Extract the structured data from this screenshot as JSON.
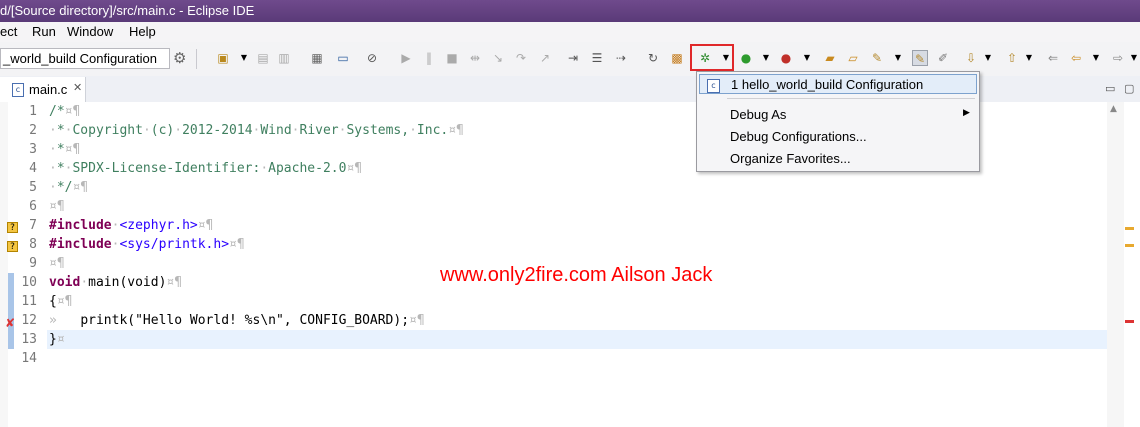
{
  "window": {
    "title": "d/[Source directory]/src/main.c - Eclipse IDE"
  },
  "menu": [
    "ect",
    "Run",
    "Window",
    "Help"
  ],
  "toolbar": {
    "launch_config": "_world_build Configuration"
  },
  "tab": {
    "label": "main.c"
  },
  "editor": {
    "line_numbers": [
      "1",
      "2",
      "3",
      "4",
      "5",
      "6",
      "7",
      "8",
      "9",
      "10",
      "11",
      "12",
      "13",
      "14"
    ],
    "lines": [
      {
        "parts": [
          {
            "c": "cm",
            "t": "/*"
          },
          {
            "c": "ws",
            "t": "¤¶"
          }
        ]
      },
      {
        "parts": [
          {
            "c": "ws",
            "t": "·"
          },
          {
            "c": "cm",
            "t": "*"
          },
          {
            "c": "ws",
            "t": "·"
          },
          {
            "c": "cm",
            "t": "Copyright"
          },
          {
            "c": "ws",
            "t": "·"
          },
          {
            "c": "cm",
            "t": "(c)"
          },
          {
            "c": "ws",
            "t": "·"
          },
          {
            "c": "cm",
            "t": "2012-2014"
          },
          {
            "c": "ws",
            "t": "·"
          },
          {
            "c": "cm",
            "t": "Wind"
          },
          {
            "c": "ws",
            "t": "·"
          },
          {
            "c": "cm",
            "t": "River"
          },
          {
            "c": "ws",
            "t": "·"
          },
          {
            "c": "cm",
            "t": "Systems,"
          },
          {
            "c": "ws",
            "t": "·"
          },
          {
            "c": "cm",
            "t": "Inc."
          },
          {
            "c": "ws",
            "t": "¤¶"
          }
        ]
      },
      {
        "parts": [
          {
            "c": "ws",
            "t": "·"
          },
          {
            "c": "cm",
            "t": "*"
          },
          {
            "c": "ws",
            "t": "¤¶"
          }
        ]
      },
      {
        "parts": [
          {
            "c": "ws",
            "t": "·"
          },
          {
            "c": "cm",
            "t": "*"
          },
          {
            "c": "ws",
            "t": "·"
          },
          {
            "c": "cm",
            "t": "SPDX-License-Identifier:"
          },
          {
            "c": "ws",
            "t": "·"
          },
          {
            "c": "cm",
            "t": "Apache-2.0"
          },
          {
            "c": "ws",
            "t": "¤¶"
          }
        ]
      },
      {
        "parts": [
          {
            "c": "ws",
            "t": "·"
          },
          {
            "c": "cm",
            "t": "*/"
          },
          {
            "c": "ws",
            "t": "¤¶"
          }
        ]
      },
      {
        "parts": [
          {
            "c": "ws",
            "t": "¤¶"
          }
        ]
      },
      {
        "parts": [
          {
            "c": "kw",
            "t": "#include"
          },
          {
            "c": "ws",
            "t": "·"
          },
          {
            "c": "st",
            "t": "<zephyr.h>"
          },
          {
            "c": "ws",
            "t": "¤¶"
          }
        ]
      },
      {
        "parts": [
          {
            "c": "kw",
            "t": "#include"
          },
          {
            "c": "ws",
            "t": "·"
          },
          {
            "c": "st",
            "t": "<sys/printk.h>"
          },
          {
            "c": "ws",
            "t": "¤¶"
          }
        ]
      },
      {
        "parts": [
          {
            "c": "ws",
            "t": "¤¶"
          }
        ]
      },
      {
        "parts": [
          {
            "c": "kw",
            "t": "void"
          },
          {
            "c": "ws",
            "t": "·"
          },
          {
            "c": "",
            "t": "main(void)"
          },
          {
            "c": "ws",
            "t": "¤¶"
          }
        ]
      },
      {
        "parts": [
          {
            "c": "",
            "t": "{"
          },
          {
            "c": "ws",
            "t": "¤¶"
          }
        ]
      },
      {
        "parts": [
          {
            "c": "ws",
            "t": "»   "
          },
          {
            "c": "",
            "t": "printk(\"Hello World! %s\\n\", CONFIG_BOARD);"
          },
          {
            "c": "ws",
            "t": "¤¶"
          }
        ]
      },
      {
        "parts": [
          {
            "c": "",
            "t": "}"
          },
          {
            "c": "ws",
            "t": "¤"
          }
        ]
      },
      {
        "parts": []
      }
    ]
  },
  "debug_menu": {
    "items": [
      "1 hello_world_build Configuration",
      "Debug As",
      "Debug Configurations...",
      "Organize Favorites..."
    ]
  },
  "watermark": "www.only2fire.com  Ailson Jack",
  "colors": {
    "highlight": "#e0282a",
    "watermark": "#ff0000"
  },
  "icons": [
    "gear-icon",
    "debug-icon",
    "run-icon",
    "close-icon",
    "c-file-icon",
    "warning-icon",
    "error-icon"
  ]
}
